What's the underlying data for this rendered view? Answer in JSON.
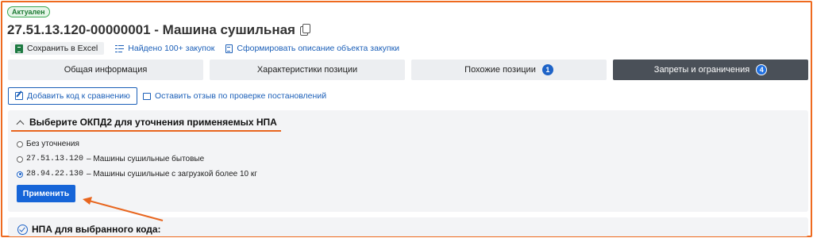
{
  "status": {
    "label": "Актуален",
    "color": "#3aa851"
  },
  "header": {
    "title": "27.51.13.120-00000001 - Машина сушильная"
  },
  "actions": {
    "excel": "Сохранить в Excel",
    "found": "Найдено 100+ закупок",
    "describe": "Сформировать описание объекта закупки"
  },
  "tabs": [
    {
      "label": "Общая информация",
      "count": ""
    },
    {
      "label": "Характеристики позиции",
      "count": ""
    },
    {
      "label": "Похожие позиции",
      "count": "1"
    },
    {
      "label": "Запреты и ограничения",
      "count": "4"
    }
  ],
  "buttons": {
    "compare": "Добавить код к сравнению",
    "review": "Оставить отзыв по проверке постановлений",
    "apply": "Применить"
  },
  "okpd_section": {
    "title": "Выберите ОКПД2 для уточнения применяемых НПА",
    "options": [
      {
        "code": "",
        "text": "Без уточнения",
        "selected": false
      },
      {
        "code": "27.51.13.120",
        "text": " – Машины сушильные бытовые",
        "selected": false
      },
      {
        "code": "28.94.22.130",
        "text": " – Машины сушильные с загрузкой более 10 кг",
        "selected": true
      }
    ]
  },
  "npa_section": {
    "title": "НПА для выбранного кода:"
  },
  "colors": {
    "accent": "#1665d8",
    "highlight": "#e8661f",
    "active_tab": "#4a5058"
  }
}
